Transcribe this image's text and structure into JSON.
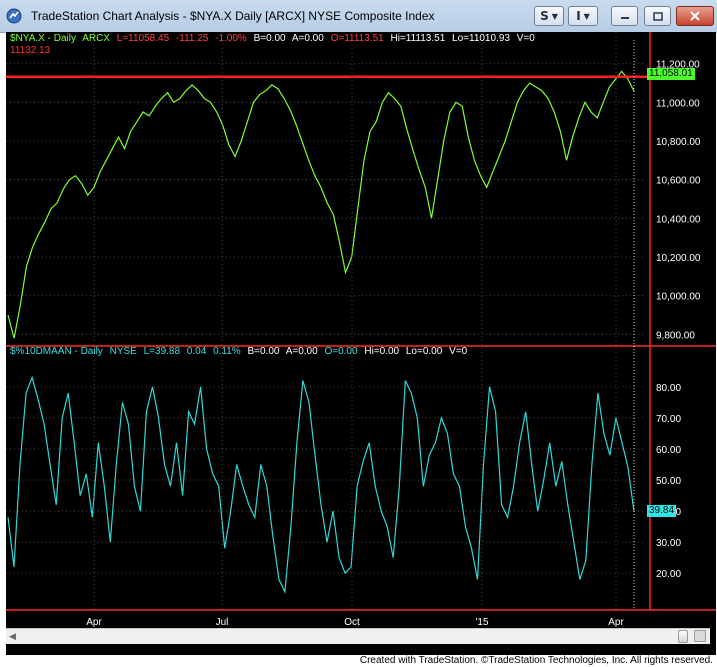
{
  "window": {
    "title": "TradeStation Chart Analysis - $NYA.X Daily [ARCX] NYSE Composite Index",
    "buttons": {
      "symbol_link": "S",
      "info": "I"
    }
  },
  "top_panel": {
    "symbol": "$NYA.X - Daily",
    "exchange": "ARCX",
    "last": "L=11058.45",
    "change": "-111.25",
    "pct_change": "-1.00%",
    "bid": "B=0.00",
    "ask": "A=0.00",
    "open": "O=11113.51",
    "high": "Hi=11113.51",
    "low": "Lo=11010.93",
    "volume": "V=0",
    "reference_level": "11132.13",
    "last_price_box": "11,058.01",
    "colors": {
      "line": "#80ff30",
      "ref": "#ff2020",
      "header_green": "#7cff3a",
      "header_red": "#ff4040"
    }
  },
  "bottom_panel": {
    "symbol": "$%10DMAAN - Daily",
    "exchange": "NYSE",
    "last": "L=39.88",
    "change": "0.04",
    "pct_change": "0.11%",
    "bid": "B=0.00",
    "ask": "A=0.00",
    "open": "O=0.00",
    "high": "Hi=0.00",
    "low": "Lo=0.00",
    "volume": "V=0",
    "last_value_box": "39.84",
    "colors": {
      "line": "#2fd8d8",
      "header_cyan": "#33e0e0",
      "box": "#2ee6e6"
    }
  },
  "chart_data": [
    {
      "type": "line",
      "series": [
        {
          "name": "$NYA.X",
          "values": [
            9900,
            9780,
            9950,
            10150,
            10250,
            10320,
            10380,
            10450,
            10480,
            10550,
            10600,
            10620,
            10580,
            10520,
            10560,
            10640,
            10700,
            10760,
            10820,
            10760,
            10850,
            10900,
            10950,
            10930,
            10980,
            11020,
            11050,
            11000,
            11020,
            11060,
            11090,
            11060,
            11020,
            11000,
            10950,
            10880,
            10780,
            10720,
            10800,
            10900,
            11000,
            11040,
            11060,
            11090,
            11070,
            11020,
            10960,
            10880,
            10790,
            10700,
            10620,
            10560,
            10480,
            10420,
            10280,
            10120,
            10200,
            10450,
            10700,
            10850,
            10900,
            11000,
            11050,
            11020,
            10980,
            10860,
            10750,
            10650,
            10560,
            10400,
            10600,
            10800,
            10950,
            11000,
            10980,
            10820,
            10700,
            10620,
            10560,
            10640,
            10720,
            10800,
            10900,
            11000,
            11060,
            11100,
            11080,
            11060,
            11020,
            10950,
            10850,
            10700,
            10820,
            10920,
            11000,
            10950,
            10920,
            11000,
            11080,
            11120,
            11160,
            11120,
            11058
          ]
        }
      ],
      "ylim": [
        9750,
        11250
      ],
      "y_ticks": [
        "11,200.00",
        "11,000.00",
        "10,800.00",
        "10,600.00",
        "10,400.00",
        "10,200.00",
        "10,000.00",
        "9,800.00"
      ],
      "y_tick_values": [
        11200,
        11000,
        10800,
        10600,
        10400,
        10200,
        10000,
        9800
      ],
      "reference_line": 11132.13
    },
    {
      "type": "line",
      "series": [
        {
          "name": "$%10DMAAN",
          "values": [
            38,
            22,
            55,
            78,
            83,
            76,
            68,
            55,
            42,
            70,
            78,
            62,
            45,
            52,
            38,
            62,
            48,
            30,
            55,
            75,
            68,
            48,
            40,
            72,
            80,
            70,
            55,
            48,
            62,
            45,
            72,
            68,
            80,
            60,
            52,
            48,
            28,
            40,
            55,
            48,
            42,
            38,
            55,
            48,
            32,
            18,
            14,
            35,
            62,
            82,
            75,
            58,
            42,
            30,
            40,
            25,
            20,
            22,
            48,
            56,
            62,
            48,
            40,
            35,
            25,
            48,
            82,
            78,
            70,
            48,
            58,
            62,
            70,
            65,
            52,
            48,
            35,
            28,
            18,
            55,
            80,
            72,
            42,
            38,
            48,
            62,
            72,
            55,
            40,
            50,
            62,
            48,
            56,
            42,
            30,
            18,
            24,
            55,
            78,
            65,
            58,
            70,
            62,
            54,
            39.84
          ]
        }
      ],
      "ylim": [
        12,
        88
      ],
      "y_ticks": [
        "80.00",
        "70.00",
        "60.00",
        "50.00",
        "40.00",
        "30.00",
        "20.00"
      ],
      "y_tick_values": [
        80,
        70,
        60,
        50,
        40,
        30,
        20
      ]
    }
  ],
  "x_axis": {
    "ticks": [
      "Apr",
      "Jul",
      "Oct",
      "'15",
      "Apr"
    ]
  },
  "footer": {
    "credit": "Created with TradeStation. ©TradeStation Technologies, Inc. All rights reserved."
  }
}
